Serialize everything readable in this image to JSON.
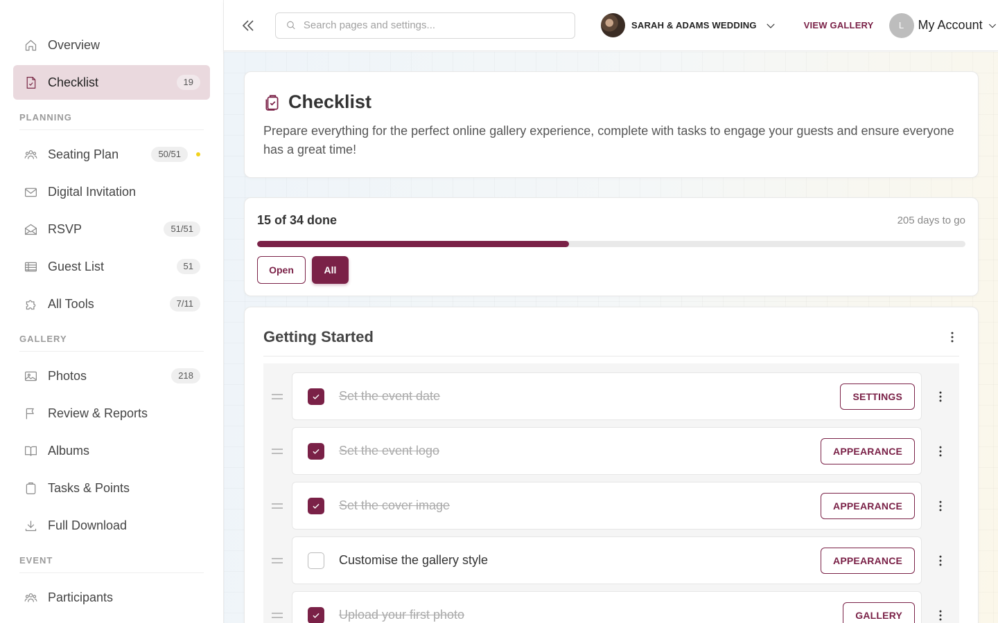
{
  "sidebar": {
    "top_items": [
      {
        "label": "Overview",
        "icon": "home-icon"
      },
      {
        "label": "Checklist",
        "icon": "checklist-icon",
        "badge": "19",
        "active": true
      }
    ],
    "sections": [
      {
        "title": "PLANNING",
        "items": [
          {
            "label": "Seating Plan",
            "icon": "people-icon",
            "badge": "50/51",
            "dot": true
          },
          {
            "label": "Digital Invitation",
            "icon": "envelope-icon"
          },
          {
            "label": "RSVP",
            "icon": "open-envelope-icon",
            "badge": "51/51"
          },
          {
            "label": "Guest List",
            "icon": "table-icon",
            "badge": "51"
          },
          {
            "label": "All Tools",
            "icon": "puzzle-icon",
            "badge": "7/11"
          }
        ]
      },
      {
        "title": "GALLERY",
        "items": [
          {
            "label": "Photos",
            "icon": "image-icon",
            "badge": "218"
          },
          {
            "label": "Review & Reports",
            "icon": "flag-icon"
          },
          {
            "label": "Albums",
            "icon": "book-icon"
          },
          {
            "label": "Tasks & Points",
            "icon": "clipboard-icon"
          },
          {
            "label": "Full Download",
            "icon": "download-icon"
          }
        ]
      },
      {
        "title": "EVENT",
        "items": [
          {
            "label": "Participants",
            "icon": "people-icon"
          }
        ]
      }
    ]
  },
  "topbar": {
    "search_placeholder": "Search pages and settings...",
    "event_name": "SARAH & ADAMS WEDDING",
    "view_gallery": "VIEW GALLERY",
    "account_initial": "L",
    "account_label": "My Account"
  },
  "header": {
    "title": "Checklist",
    "description": "Prepare everything for the perfect online gallery experience, complete with tasks to engage your guests and ensure everyone has a great time!"
  },
  "progress": {
    "done_text": "15 of 34 done",
    "days_text": "205 days to go",
    "fraction": 0.44,
    "filter_open": "Open",
    "filter_all": "All",
    "accent": "#7a2147"
  },
  "tasks": {
    "section_title": "Getting Started",
    "items": [
      {
        "label": "Set the event date",
        "done": true,
        "button": "SETTINGS"
      },
      {
        "label": "Set the event logo",
        "done": true,
        "button": "APPEARANCE"
      },
      {
        "label": "Set the cover image",
        "done": true,
        "button": "APPEARANCE"
      },
      {
        "label": "Customise the gallery style",
        "done": false,
        "button": "APPEARANCE"
      },
      {
        "label": "Upload your first photo",
        "done": true,
        "button": "GALLERY"
      }
    ]
  }
}
